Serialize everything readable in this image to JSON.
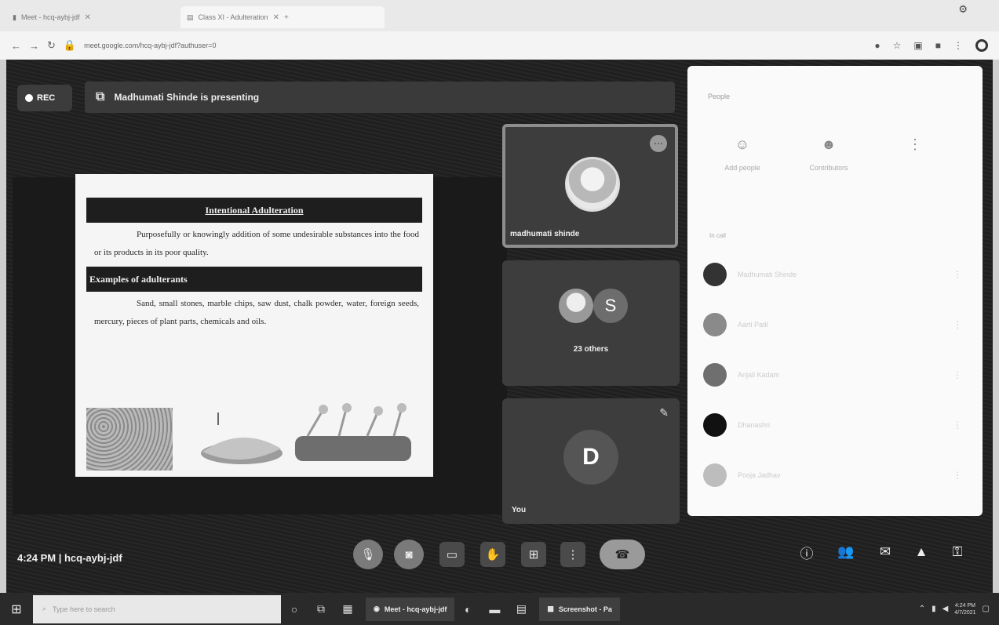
{
  "browser": {
    "tabs": [
      {
        "label": "Meet - hcq-aybj-jdf"
      },
      {
        "label": "Class XI - Adulteration"
      }
    ],
    "url": "meet.google.com/hcq-aybj-jdf?authuser=0",
    "window_icon": "gear-icon"
  },
  "meet": {
    "rec_label": "REC",
    "presenting_text": "Madhumati Shinde is presenting",
    "meeting_info": "4:24 PM  |  hcq-aybj-jdf",
    "participants": {
      "tile1_name": "madhumati shinde",
      "tile2_avatar_letter": "S",
      "tile2_label": "23 others",
      "tile3_avatar_letter": "D",
      "tile3_name": "You"
    }
  },
  "slide": {
    "heading1": "Intentional Adulteration",
    "body1": "Purposefully or knowingly addition of some undesirable substances into the food or its products in its poor quality.",
    "heading2": "Examples of adulterants",
    "body2": "Sand, small stones, marble chips, saw dust, chalk powder, water, foreign seeds, mercury, pieces of plant parts, chemicals and oils."
  },
  "panel": {
    "title": "People",
    "tabs": [
      {
        "icon": "person-icon",
        "label": "Add people"
      },
      {
        "icon": "people-icon",
        "label": "Contributors"
      },
      {
        "icon": "more-icon",
        "label": ""
      }
    ],
    "section_label": "In call",
    "people": [
      {
        "name": "Madhumati Shinde",
        "color": "#333333"
      },
      {
        "name": "Aarti Patil",
        "color": "#8a8a8a"
      },
      {
        "name": "Anjali Kadam",
        "color": "#6f6f6f"
      },
      {
        "name": "Dhanashri",
        "color": "#111111"
      },
      {
        "name": "Pooja Jadhav",
        "color": "#bdbdbd"
      }
    ]
  },
  "taskbar": {
    "search_placeholder": "Type here to search",
    "app1_label": "Meet - hcq-aybj-jdf",
    "app2_label": "Screenshot - Pa",
    "clock_time": "4:24 PM",
    "clock_date": "4/7/2021"
  }
}
